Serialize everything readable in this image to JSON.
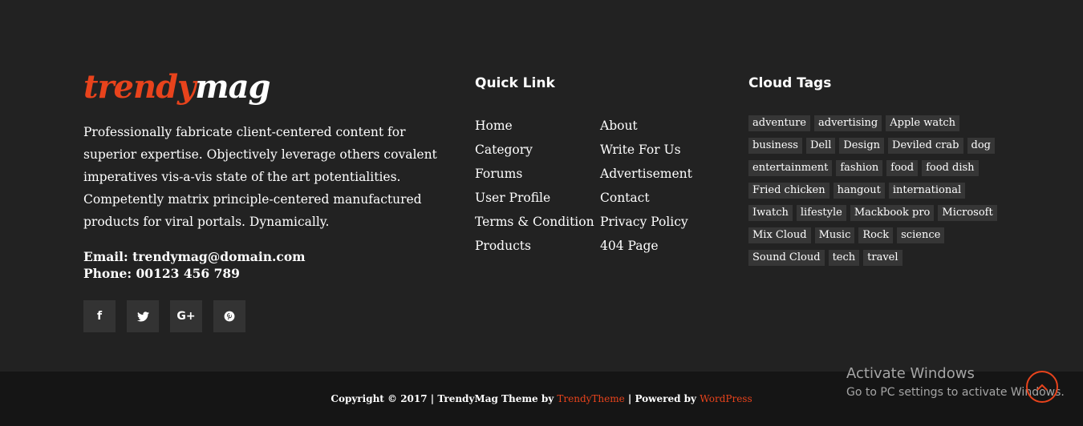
{
  "brand": {
    "logo_part1": "trendy",
    "logo_part2": "mag",
    "accent_color": "#e8431c"
  },
  "about": {
    "text": "Professionally fabricate client-centered content for superior expertise. Objectively leverage others covalent imperatives vis-a-vis state of the art potentialities. Competently matrix principle-centered manufactured products for viral portals. Dynamically.",
    "email": "Email: trendymag@domain.com",
    "phone": "Phone: 00123 456 789"
  },
  "socials": [
    {
      "name": "facebook-icon",
      "glyph": "f"
    },
    {
      "name": "twitter-icon",
      "glyph": ""
    },
    {
      "name": "google-plus-icon",
      "glyph": "G+"
    },
    {
      "name": "pinterest-icon",
      "glyph": ""
    }
  ],
  "quick_link": {
    "title": "Quick Link",
    "col1": [
      "Home",
      "Category",
      "Forums",
      "User Profile",
      "Terms & Condition",
      "Products"
    ],
    "col2": [
      "About",
      "Write For Us",
      "Advertisement",
      "Contact",
      "Privacy Policy",
      "404 Page"
    ]
  },
  "cloud_tags": {
    "title": "Cloud Tags",
    "rows": [
      [
        "adventure",
        "advertising",
        "Apple watch"
      ],
      [
        "business",
        "Dell",
        "Design",
        "Deviled crab",
        "dog"
      ],
      [
        "entertainment",
        "fashion",
        "food",
        "food dish"
      ],
      [
        "Fried chicken",
        "hangout",
        "international"
      ],
      [
        "Iwatch",
        "lifestyle",
        "Mackbook pro",
        "Microsoft"
      ],
      [
        "Mix Cloud",
        "Music",
        "Rock",
        "science"
      ],
      [
        "Sound Cloud",
        "tech",
        "travel"
      ]
    ]
  },
  "footer_bottom": {
    "copyright_prefix": "Copyright © 2017 | TrendyMag Theme by ",
    "theme_link": "TrendyTheme",
    "separator": " | Powered by ",
    "wp_link": "WordPress"
  },
  "watermark": {
    "line1": "Activate Windows",
    "line2": "Go to PC settings to activate Windows."
  }
}
